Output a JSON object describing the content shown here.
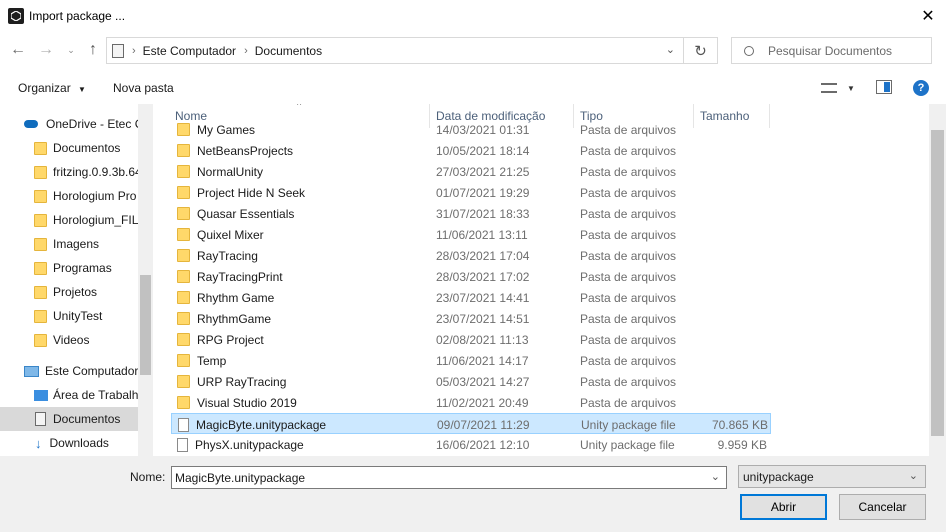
{
  "window": {
    "title": "Import package ..."
  },
  "address": {
    "crumbs": [
      "Este Computador",
      "Documentos"
    ]
  },
  "search": {
    "placeholder": "Pesquisar Documentos"
  },
  "toolbar": {
    "organize": "Organizar",
    "new_folder": "Nova pasta"
  },
  "sidebar": {
    "items": [
      {
        "label": "OneDrive - Etec C",
        "icon": "onedrive-cloud-icon"
      },
      {
        "label": "Documentos",
        "icon": "folder-icon"
      },
      {
        "label": "fritzing.0.9.3b.64",
        "icon": "folder-icon"
      },
      {
        "label": "Horologium Pro",
        "icon": "folder-icon"
      },
      {
        "label": "Horologium_FIL",
        "icon": "folder-icon"
      },
      {
        "label": "Imagens",
        "icon": "folder-icon"
      },
      {
        "label": "Programas",
        "icon": "folder-icon"
      },
      {
        "label": "Projetos",
        "icon": "folder-icon"
      },
      {
        "label": "UnityTest",
        "icon": "folder-icon"
      },
      {
        "label": "Videos",
        "icon": "folder-icon"
      },
      {
        "label": "Este Computador",
        "icon": "computer-icon"
      },
      {
        "label": "Área de Trabalho",
        "icon": "desktop-icon"
      },
      {
        "label": "Documentos",
        "icon": "documents-icon"
      },
      {
        "label": "Downloads",
        "icon": "downloads-icon"
      }
    ]
  },
  "columns": {
    "name": "Nome",
    "date": "Data de modificação",
    "type": "Tipo",
    "size": "Tamanho"
  },
  "files": [
    {
      "name": "My Games",
      "date": "14/03/2021 01:31",
      "type": "Pasta de arquivos",
      "size": "",
      "kind": "folder"
    },
    {
      "name": "NetBeansProjects",
      "date": "10/05/2021 18:14",
      "type": "Pasta de arquivos",
      "size": "",
      "kind": "folder"
    },
    {
      "name": "NormalUnity",
      "date": "27/03/2021 21:25",
      "type": "Pasta de arquivos",
      "size": "",
      "kind": "folder"
    },
    {
      "name": "Project Hide N Seek",
      "date": "01/07/2021 19:29",
      "type": "Pasta de arquivos",
      "size": "",
      "kind": "folder"
    },
    {
      "name": "Quasar Essentials",
      "date": "31/07/2021 18:33",
      "type": "Pasta de arquivos",
      "size": "",
      "kind": "folder"
    },
    {
      "name": "Quixel Mixer",
      "date": "11/06/2021 13:11",
      "type": "Pasta de arquivos",
      "size": "",
      "kind": "folder"
    },
    {
      "name": "RayTracing",
      "date": "28/03/2021 17:04",
      "type": "Pasta de arquivos",
      "size": "",
      "kind": "folder"
    },
    {
      "name": "RayTracingPrint",
      "date": "28/03/2021 17:02",
      "type": "Pasta de arquivos",
      "size": "",
      "kind": "folder"
    },
    {
      "name": "Rhythm Game",
      "date": "23/07/2021 14:41",
      "type": "Pasta de arquivos",
      "size": "",
      "kind": "folder"
    },
    {
      "name": "RhythmGame",
      "date": "23/07/2021 14:51",
      "type": "Pasta de arquivos",
      "size": "",
      "kind": "folder"
    },
    {
      "name": "RPG Project",
      "date": "02/08/2021 11:13",
      "type": "Pasta de arquivos",
      "size": "",
      "kind": "folder"
    },
    {
      "name": "Temp",
      "date": "11/06/2021 14:17",
      "type": "Pasta de arquivos",
      "size": "",
      "kind": "folder"
    },
    {
      "name": "URP RayTracing",
      "date": "05/03/2021 14:27",
      "type": "Pasta de arquivos",
      "size": "",
      "kind": "folder"
    },
    {
      "name": "Visual Studio 2019",
      "date": "11/02/2021 20:49",
      "type": "Pasta de arquivos",
      "size": "",
      "kind": "folder"
    },
    {
      "name": "MagicByte.unitypackage",
      "date": "09/07/2021 11:29",
      "type": "Unity package file",
      "size": "70.865 KB",
      "kind": "file"
    },
    {
      "name": "PhysX.unitypackage",
      "date": "16/06/2021 12:10",
      "type": "Unity package file",
      "size": "9.959 KB",
      "kind": "file"
    }
  ],
  "footer": {
    "name_label": "Nome:",
    "name_value": "MagicByte.unitypackage",
    "filetype": "unitypackage",
    "open": "Abrir",
    "cancel": "Cancelar"
  },
  "colors": {
    "selection": "#cce8ff",
    "selection_border": "#99d1ff",
    "accent": "#0078d7"
  }
}
